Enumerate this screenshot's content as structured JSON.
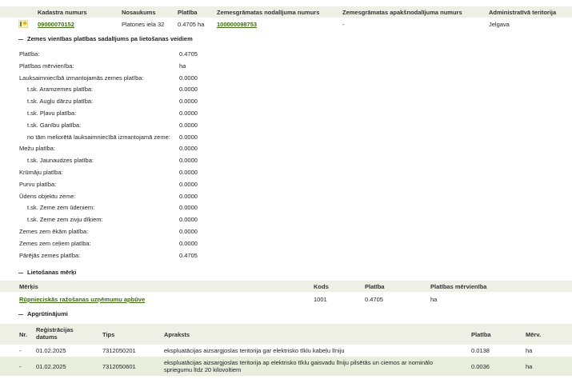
{
  "top_table": {
    "headers": [
      "Kadastra numurs",
      "Nosaukums",
      "Platība",
      "Zemesgrāmatas nodalījuma numurs",
      "Zemesgrāmatas apakšnodalījuma numurs",
      "Administratīvā teritorija"
    ],
    "row": {
      "kadastra_numurs": "09000070152",
      "nosaukums": "Platones iela 32",
      "platiba": "0.4705 ha",
      "nodalijuma_numurs": "100000098753",
      "apaksnodalijuma_numurs": "-",
      "teritorija": "Jelgava"
    }
  },
  "section1": {
    "title": "Zemes vienības platības sadalījums pa lietošanas veidiem",
    "items": [
      {
        "label": "Platība:",
        "value": "0.4705",
        "indent": false
      },
      {
        "label": "Platības mērvienība:",
        "value": "ha",
        "indent": false
      },
      {
        "label": "Lauksaimniecībā izmantojamās zemes platība:",
        "value": "0.0000",
        "indent": false
      },
      {
        "label": "t.sk. Aramzemes platība:",
        "value": "0.0000",
        "indent": true
      },
      {
        "label": "t.sk. Augļu dārzu platība:",
        "value": "0.0000",
        "indent": true
      },
      {
        "label": "t.sk. Pļavu platība:",
        "value": "0.0000",
        "indent": true
      },
      {
        "label": "t.sk. Ganību platība:",
        "value": "0.0000",
        "indent": true
      },
      {
        "label": "no tām meliorētā lauksaimniecībā izmantojamā zeme:",
        "value": "0.0000",
        "indent": true
      },
      {
        "label": "Mežu platība:",
        "value": "0.0000",
        "indent": false
      },
      {
        "label": "t.sk. Jaunaudzes platība:",
        "value": "0.0000",
        "indent": true
      },
      {
        "label": "Krūmāju platība:",
        "value": "0.0000",
        "indent": false
      },
      {
        "label": "Purvu platība:",
        "value": "0.0000",
        "indent": false
      },
      {
        "label": "Ūdens objektu zeme:",
        "value": "0.0000",
        "indent": false
      },
      {
        "label": "t.sk. Zeme zem ūdeņiem:",
        "value": "0.0000",
        "indent": true
      },
      {
        "label": "t.sk. Zeme zem zivju dīķiem:",
        "value": "0.0000",
        "indent": true
      },
      {
        "label": "Zemes zem ēkām platība:",
        "value": "0.0000",
        "indent": false
      },
      {
        "label": "Zemes zem ceļiem platība:",
        "value": "0.0000",
        "indent": false
      },
      {
        "label": "Pārējās zemes platība:",
        "value": "0.4705",
        "indent": false
      }
    ]
  },
  "section2": {
    "title": "Lietošanas mērķi",
    "headers": [
      "Mērķis",
      "Kods",
      "Platība",
      "Platības mērvienība"
    ],
    "row": {
      "merkis": "Rūpnieciskās ražošanas uzņēmumu apbūve",
      "kods": "1001",
      "platiba": "0.4705",
      "mervieniba": "ha"
    }
  },
  "section3": {
    "title": "Apgrūtinājumi",
    "headers": [
      "Nr.",
      "Reģistrācijas datums",
      "Tips",
      "Apraksts",
      "Platība",
      "Mērv."
    ],
    "rows": [
      {
        "nr": "-",
        "datums": "01.02.2025",
        "tips": "7312050201",
        "apraksts": "ekspluatācijas aizsargjoslas teritorija gar elektrisko tīklu kabeļu līniju",
        "platiba": "0.0138",
        "merv": "ha"
      },
      {
        "nr": "-",
        "datums": "01.02.2025",
        "tips": "7312050601",
        "apraksts": "ekspluatācijas aizsargjoslas teritorija ap elektrisko tīklu gaisvadu līniju pilsētās un ciemos ar nominālo spriegumu līdz 20 kilovoltiem",
        "platiba": "0.0036",
        "merv": "ha"
      }
    ]
  }
}
